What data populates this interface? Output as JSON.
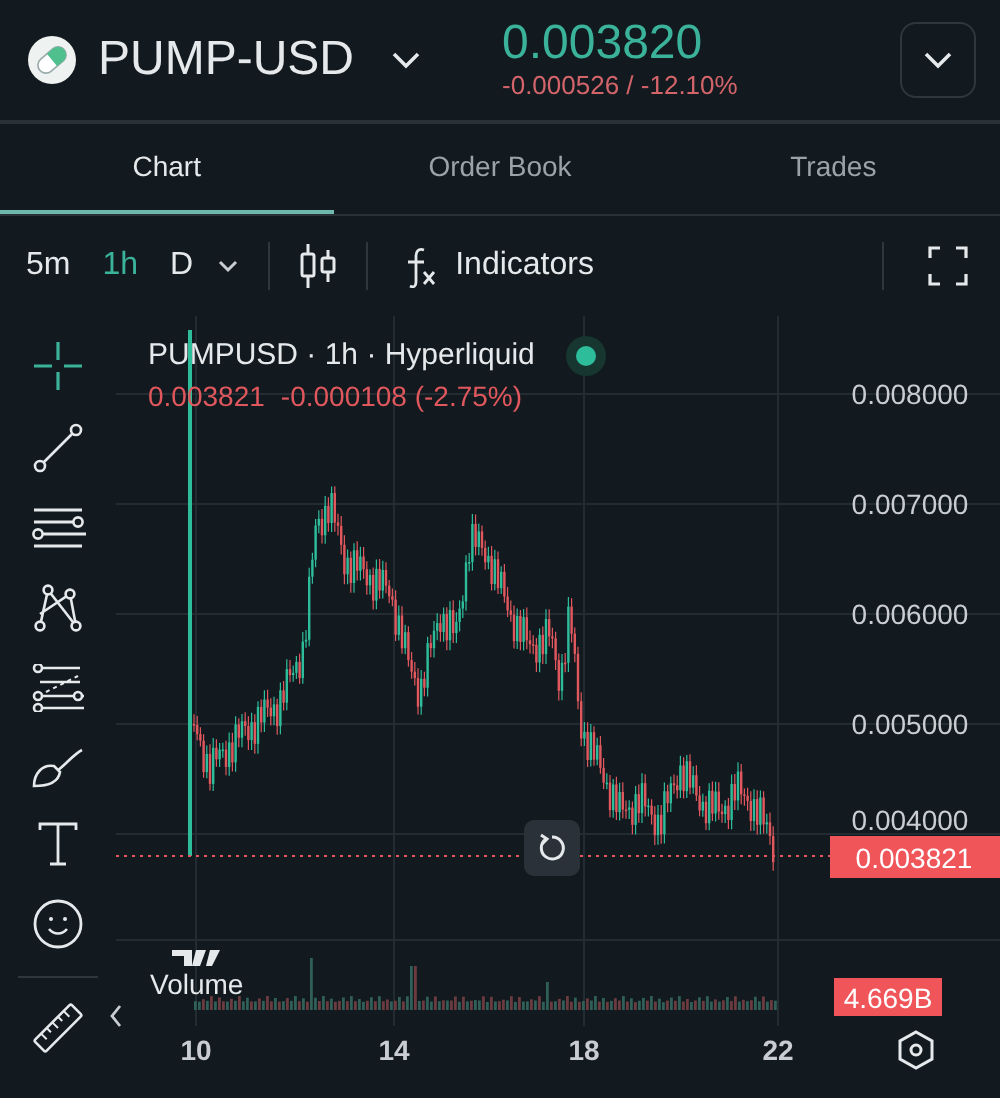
{
  "header": {
    "symbol": "PUMP-USD",
    "price": "0.003820",
    "change": "-0.000526 / -12.10%"
  },
  "tabs": [
    {
      "label": "Chart",
      "selected": true
    },
    {
      "label": "Order Book",
      "selected": false
    },
    {
      "label": "Trades",
      "selected": false
    }
  ],
  "intervals": [
    {
      "label": "5m",
      "selected": false
    },
    {
      "label": "1h",
      "selected": true
    },
    {
      "label": "D",
      "selected": false
    }
  ],
  "toolbar": {
    "indicators": "Indicators"
  },
  "legend": {
    "title": "PUMPUSD · 1h · Hyperliquid",
    "price": "0.003821",
    "change": "-0.000108 (-2.75%)"
  },
  "price_axis": [
    "0.008000",
    "0.007000",
    "0.006000",
    "0.005000",
    "0.004000"
  ],
  "last_price_badge": "0.003821",
  "volume": {
    "label": "Volume",
    "badge": "4.669B"
  },
  "time_axis": [
    "10",
    "14",
    "18",
    "22"
  ]
}
